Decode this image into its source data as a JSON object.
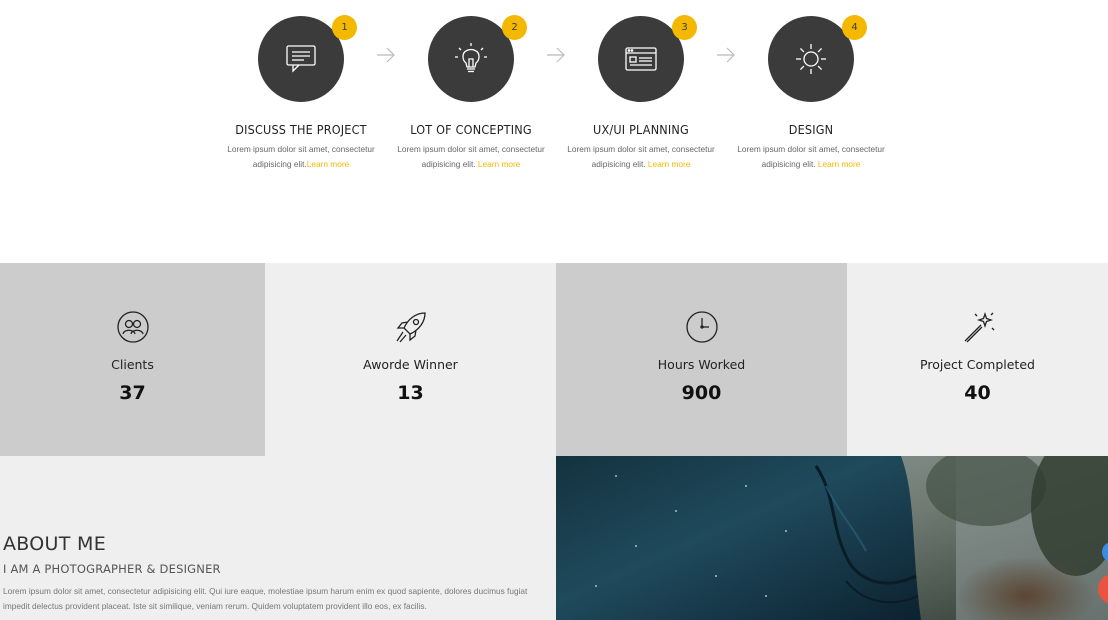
{
  "steps": [
    {
      "number": "1",
      "title": "DISCUSS THE PROJECT",
      "desc": "Lorem ipsum dolor sit amet, consectetur adipisicing elit.",
      "link": "Learn more",
      "icon": "chat-icon"
    },
    {
      "number": "2",
      "title": "LOT OF CONCEPTING",
      "desc": "Lorem ipsum dolor sit amet, consectetur adipisicing elit.",
      "link": "Learn more",
      "icon": "lightbulb-icon"
    },
    {
      "number": "3",
      "title": "UX/UI PLANNING",
      "desc": "Lorem ipsum dolor sit amet, consectetur adipisicing elit.",
      "link": "Learn more",
      "icon": "browser-window-icon"
    },
    {
      "number": "4",
      "title": "DESIGN",
      "desc": "Lorem ipsum dolor sit amet, consectetur adipisicing elit.",
      "link": "Learn more",
      "icon": "sun-icon"
    }
  ],
  "stats": [
    {
      "label": "Clients",
      "value": "37",
      "icon": "clients-icon",
      "bg": "#cccccc"
    },
    {
      "label": "Aworde Winner",
      "value": "13",
      "icon": "rocket-icon",
      "bg": "#efefef"
    },
    {
      "label": "Hours Worked",
      "value": "900",
      "icon": "clock-icon",
      "bg": "#cccccc"
    },
    {
      "label": "Project Completed",
      "value": "40",
      "icon": "magic-wand-icon",
      "bg": "#efefef"
    }
  ],
  "about": {
    "title": "ABOUT ME",
    "subtitle": "I AM A PHOTOGRAPHER & DESIGNER",
    "text": "Lorem ipsum dolor sit amet, consectetur adipisicing elit. Qui iure eaque, molestiae ipsum harum enim ex quod sapiente, dolores ducimus fugiat impedit delectus provident placeat. Iste sit similique, veniam rerum. Quidem voluptatem provident illo eos, ex facilis."
  },
  "colors": {
    "accent": "#f5b800",
    "circle": "#3b3b3b",
    "panel_dark": "#cccccc",
    "panel_light": "#efefef"
  }
}
